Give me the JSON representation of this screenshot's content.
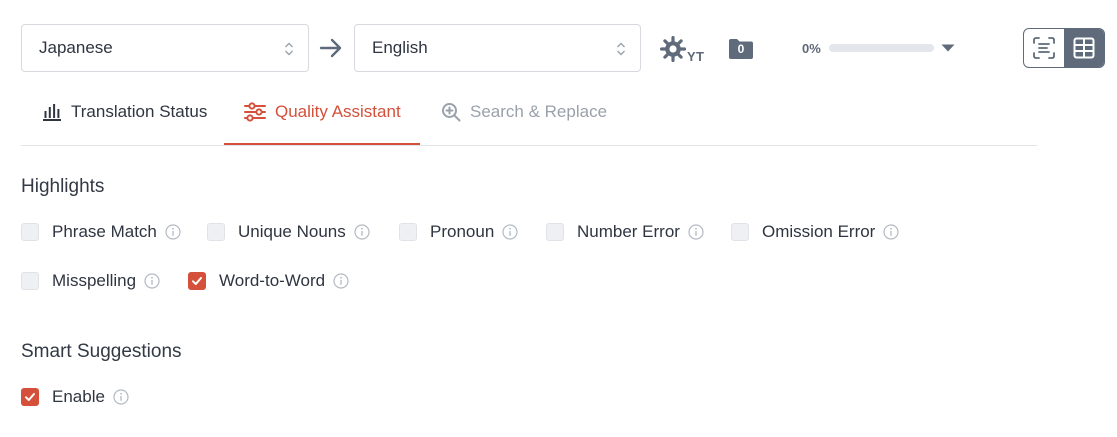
{
  "toolbar": {
    "source_language": "Japanese",
    "target_language": "English",
    "arrow_icon": "arrow-right-icon",
    "settings_icon": "gear-icon",
    "settings_suffix": "YT",
    "folder_icon": "folder-icon",
    "folder_count": "0",
    "progress_percent_label": "0%",
    "progress_fraction": 0.0,
    "view_toggle": {
      "options": [
        "list-view-icon",
        "grid-view-icon"
      ],
      "selected": "grid-view-icon"
    }
  },
  "tabs": [
    {
      "label": "Translation Status",
      "icon": "bar-chart-icon",
      "active": false
    },
    {
      "label": "Quality Assistant",
      "icon": "sliders-icon",
      "active": true
    },
    {
      "label": "Search & Replace",
      "icon": "search-plus-icon",
      "active": false
    }
  ],
  "highlights": {
    "title": "Highlights",
    "options": [
      {
        "label": "Phrase Match",
        "checked": false
      },
      {
        "label": "Unique Nouns",
        "checked": false
      },
      {
        "label": "Pronoun",
        "checked": false
      },
      {
        "label": "Number Error",
        "checked": false
      },
      {
        "label": "Omission Error",
        "checked": false
      },
      {
        "label": "Misspelling",
        "checked": false
      },
      {
        "label": "Word-to-Word",
        "checked": true
      }
    ]
  },
  "smart_suggestions": {
    "title": "Smart Suggestions",
    "options": [
      {
        "label": "Enable",
        "checked": true
      }
    ]
  },
  "colors": {
    "accent": "#d4503a",
    "icon_gray": "#5f6b7a",
    "text": "#2f3540",
    "inactive_text": "#9aa1ab"
  }
}
